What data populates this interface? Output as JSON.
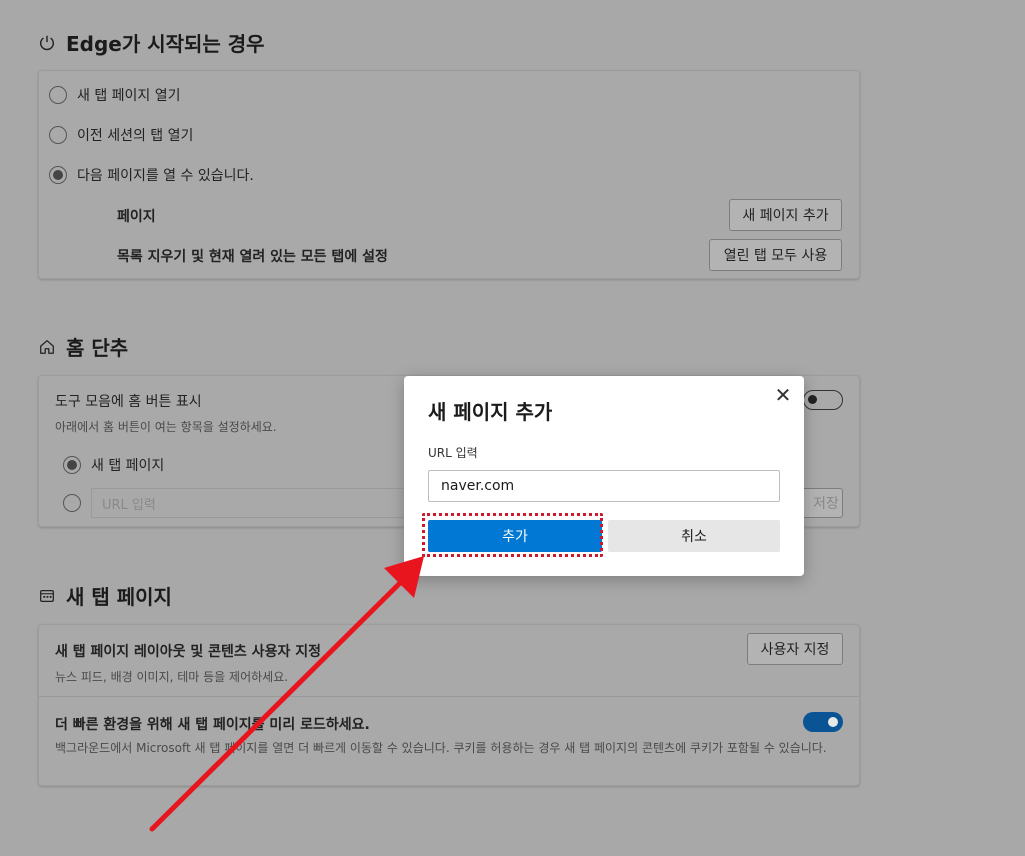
{
  "startup": {
    "title": "Edge가 시작되는 경우",
    "options": [
      {
        "label": "새 탭 페이지 열기",
        "checked": false
      },
      {
        "label": "이전 세션의 탭 열기",
        "checked": false
      },
      {
        "label": "다음 페이지를 열 수 있습니다.",
        "checked": true
      }
    ],
    "pages_label": "페이지",
    "add_new_page_button": "새 페이지 추가",
    "clear_list_label": "목록 지우기 및 현재 열려 있는 모든 탭에 설정",
    "use_all_open_tabs_button": "열린 탭 모두 사용"
  },
  "home": {
    "title": "홈 단추",
    "show_home_button_label": "도구 모음에 홈 버튼 표시",
    "show_home_button_desc": "아래에서 홈 버튼이 여는 항목을 설정하세요.",
    "show_home_button_enabled": false,
    "option_new_tab": "새 탭 페이지",
    "url_placeholder": "URL 입력",
    "save_button": "저장"
  },
  "new_tab": {
    "title": "새 탭 페이지",
    "customize_label": "새 탭 페이지 레이아웃 및 콘텐츠 사용자 지정",
    "customize_desc": "뉴스 피드, 배경 이미지, 테마 등을 제어하세요.",
    "customize_button": "사용자 지정",
    "preload_label": "더 빠른 환경을 위해 새 탭 페이지를 미리 로드하세요.",
    "preload_desc": "백그라운드에서 Microsoft 새 탭 페이지를 열면 더 빠르게 이동할 수 있습니다. 쿠키를 허용하는 경우 새 탭 페이지의 콘텐츠에 쿠키가 포함될 수 있습니다.",
    "preload_enabled": true
  },
  "dialog": {
    "title": "새 페이지 추가",
    "url_label": "URL 입력",
    "url_value": "naver.com",
    "add_button": "추가",
    "cancel_button": "취소"
  },
  "colors": {
    "primary": "#0078d4",
    "annotation": "#e8141e",
    "focus_outline": "#d0182b"
  }
}
